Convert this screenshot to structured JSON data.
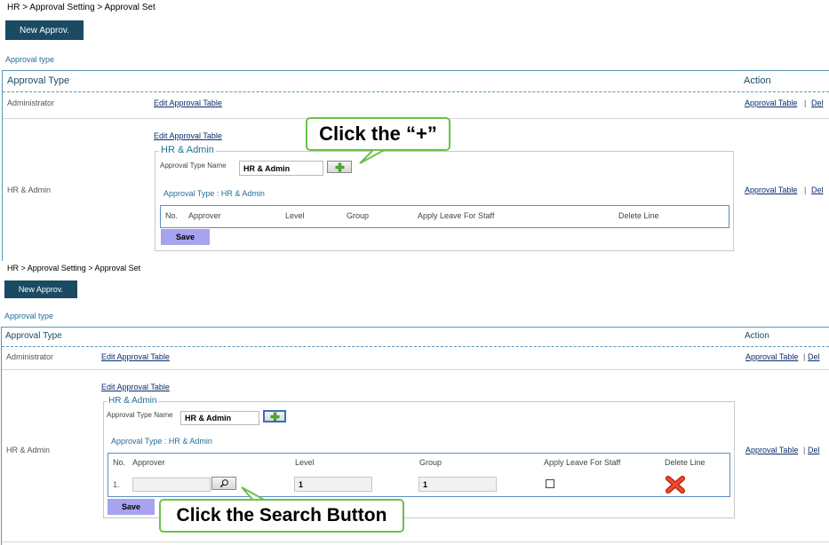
{
  "panel1": {
    "breadcrumb": "HR > Approval Setting > Approval Set",
    "new_button": "New Approv.",
    "approval_type_label": "Approval type",
    "table": {
      "header_type": "Approval Type",
      "header_action": "Action",
      "rows": [
        {
          "name": "Administrator",
          "edit_link": "Edit Approval Table",
          "approval_table_link": "Approval Table",
          "separator": "|",
          "del_link": "Del"
        },
        {
          "name": "HR & Admin",
          "edit_link": "Edit Approval Table",
          "approval_table_link": "Approval Table",
          "separator": "|",
          "del_link": "Del"
        }
      ]
    },
    "editor": {
      "legend": "HR & Admin",
      "name_label": "Approval Type Name",
      "name_value": "HR & Admin",
      "subtitle": "Approval Type : HR & Admin",
      "columns": [
        "No.",
        "Approver",
        "Level",
        "Group",
        "Apply Leave For Staff",
        "Delete Line"
      ],
      "save": "Save"
    },
    "callout": "Click the “+”"
  },
  "panel2": {
    "breadcrumb": "HR > Approval Setting > Approval Set",
    "new_button": "New Approv.",
    "approval_type_label": "Approval type",
    "table": {
      "header_type": "Approval Type",
      "header_action": "Action",
      "rows": [
        {
          "name": "Administrator",
          "edit_link": "Edit Approval Table",
          "approval_table_link": "Approval Table",
          "separator": "|",
          "del_link": "Del"
        },
        {
          "name": "HR & Admin",
          "edit_link": "Edit Approval Table",
          "approval_table_link": "Approval Table",
          "separator": "|",
          "del_link": "Del"
        }
      ]
    },
    "editor": {
      "legend": "HR & Admin",
      "name_label": "Approval Type Name",
      "name_value": "HR & Admin",
      "subtitle": "Approval Type : HR & Admin",
      "columns": [
        "No.",
        "Approver",
        "Level",
        "Group",
        "Apply Leave For Staff",
        "Delete Line"
      ],
      "line": {
        "no": "1.",
        "approver": "",
        "level": "1",
        "group": "1",
        "apply_leave_checked": false
      },
      "save": "Save"
    },
    "callout": "Click the Search Button"
  },
  "colors": {
    "button_navy": "#1a4b63",
    "link_blue": "#0b2d6b",
    "accent_blue": "#236f96",
    "save_purple": "#a7a3ef",
    "callout_green": "#6cc04a",
    "delete_red": "#e0301e"
  },
  "icons": {
    "add": "green-plus-icon",
    "search": "magnifier-icon",
    "delete": "red-x-icon"
  }
}
